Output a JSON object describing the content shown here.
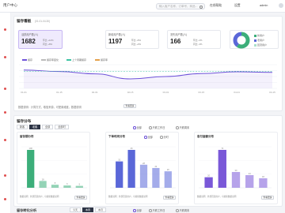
{
  "topbar": {
    "brand": "用户中心",
    "search_placeholder": "输入客户名称，订单号，商品...",
    "nav": [
      "在线帮助",
      "设置",
      "admin"
    ]
  },
  "overview": {
    "title": "留存看板",
    "subtitle": "(01.01-04.30)",
    "kpis": [
      {
        "label": "活跃用户数(人)",
        "value": "1682",
        "m1": "环比 +12%",
        "m2": "同比 +8%"
      },
      {
        "label": "新增用户数(人)",
        "value": "1197",
        "m1": "环比 +5%",
        "m2": "同比 +3%"
      },
      {
        "label": "流失用户数(人)",
        "value": "166",
        "m1": "环比 -2%",
        "m2": "同比 -4%"
      }
    ],
    "donut_legend": [
      "新用户",
      "老用户",
      "回流用户"
    ],
    "legend": [
      "留存",
      "留存率变化",
      "上个周期留存",
      "留存率"
    ],
    "x_labels": [
      "01-01",
      "01-15",
      "02-01",
      "02-15",
      "03-01",
      "03-15",
      "04-01",
      "04-15"
    ],
    "footer_text": "数据说明：计算方式，取值来源，可配置维度，数据说明",
    "footer_button": "查看更多",
    "colors": {
      "accent": "#6b4fd6",
      "line": "#6e52d9",
      "teal": "#3cc3a3"
    }
  },
  "chart_data": [
    {
      "type": "line",
      "x": [
        "01-01",
        "01-15",
        "02-01",
        "02-15",
        "03-01",
        "03-15",
        "04-01",
        "04-15"
      ],
      "series": [
        {
          "values": [
            62,
            57,
            49,
            32,
            40,
            50,
            56,
            54
          ]
        },
        {
          "values": [
            58,
            58,
            58,
            58,
            58,
            58,
            58,
            58
          ]
        }
      ],
      "ylim": [
        0,
        80
      ]
    },
    {
      "type": "bar",
      "title": "留存期分布",
      "categories": [
        "1",
        "2",
        "3",
        "4",
        "5"
      ],
      "values": [
        100,
        18,
        8,
        6,
        5
      ],
      "color": "#3cae7a"
    },
    {
      "type": "bar",
      "title": "下单时间分布",
      "categories": [
        "1",
        "2",
        "3",
        "4",
        "5"
      ],
      "values": [
        32,
        46,
        28,
        24,
        20
      ],
      "color": "#5a67d8"
    },
    {
      "type": "bar",
      "title": "客付金额分布",
      "categories": [
        "1",
        "2",
        "3",
        "4",
        "5"
      ],
      "values": [
        20,
        72,
        30,
        24,
        18
      ],
      "color": "#7a58d8"
    }
  ],
  "distribution": {
    "title": "留存分布",
    "tabs": [
      "新客",
      "老客",
      "全部",
      "全部时"
    ],
    "active_tab": 1,
    "radios": [
      "全部",
      "只看工作日",
      "只看周末"
    ],
    "panel_radios": [
      "全部",
      "分时"
    ],
    "notes": "数据说明：外部回流用户，可视化数据说明",
    "button": "查看更多"
  },
  "footer": {
    "title": "留存转化分析",
    "tabs": [
      "今天",
      "本周",
      "本月"
    ],
    "radios": [
      "全部",
      "只看工作日",
      "只看周末"
    ]
  }
}
